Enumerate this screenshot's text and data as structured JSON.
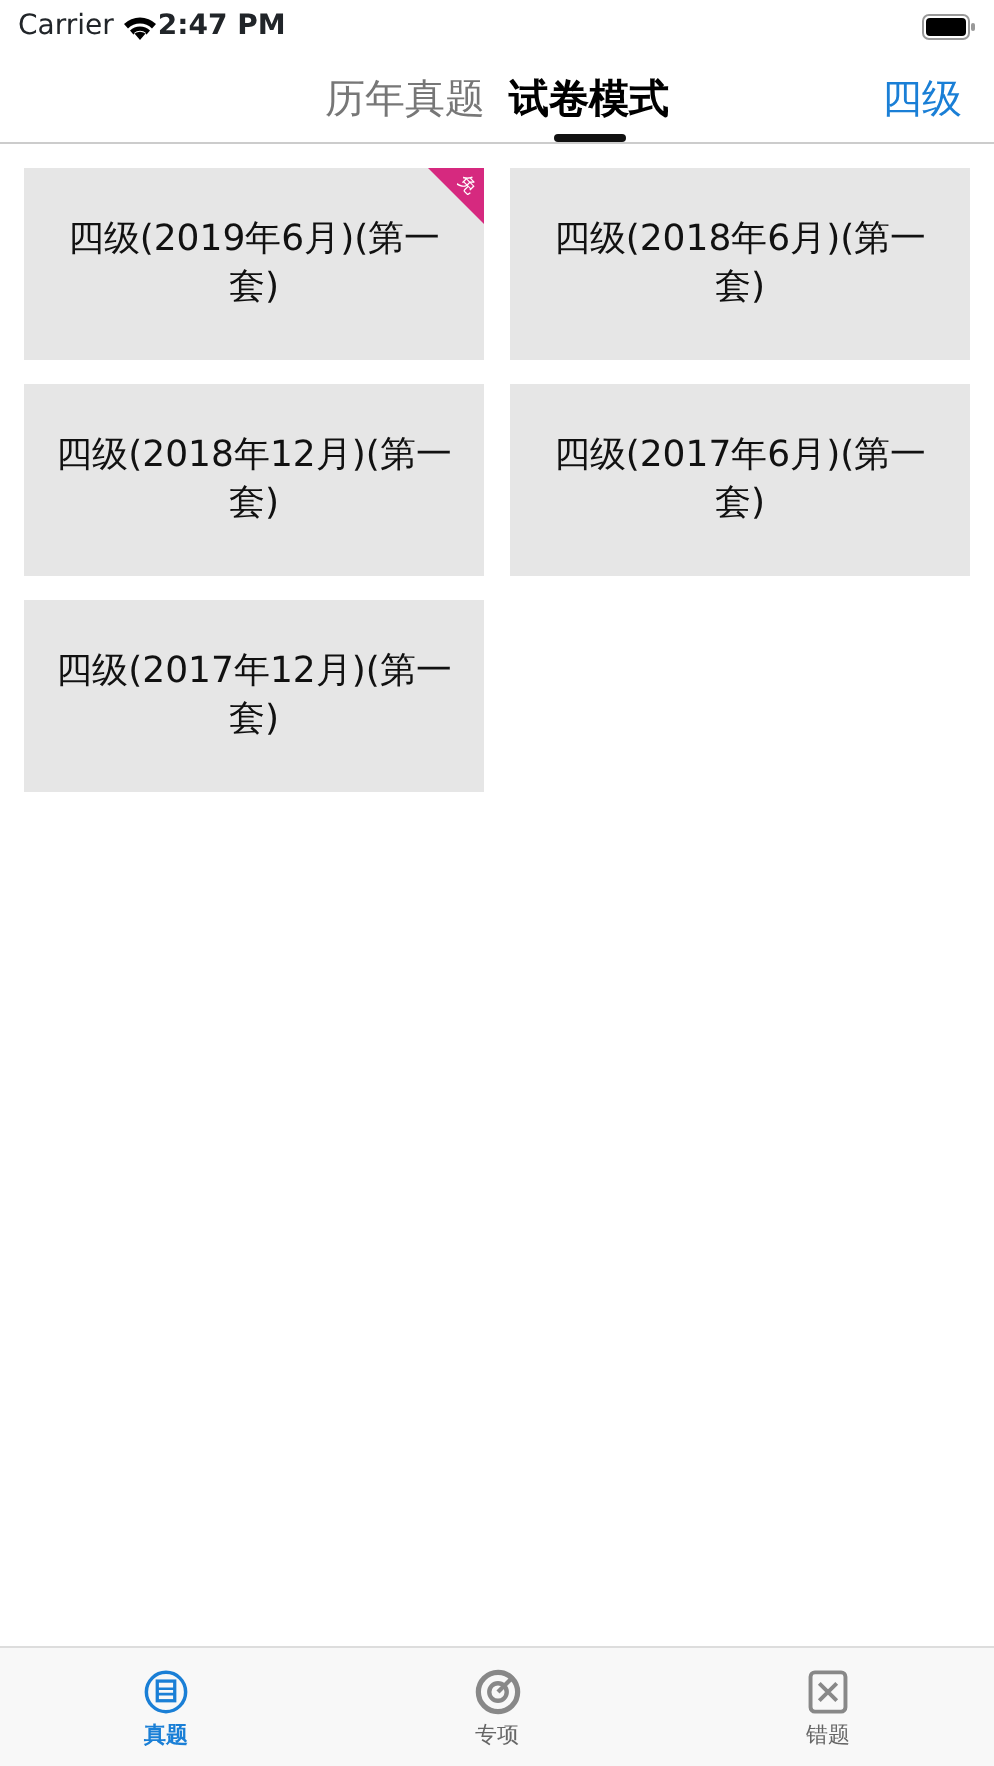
{
  "status_bar": {
    "carrier": "Carrier",
    "time": "2:47 PM"
  },
  "segments": [
    {
      "label": "历年真题",
      "selected": false
    },
    {
      "label": "试卷模式",
      "selected": true
    }
  ],
  "level_button": "四级",
  "papers": [
    {
      "title": "四级(2019年6月)(第一套)",
      "badge": "免"
    },
    {
      "title": "四级(2018年6月)(第一套)"
    },
    {
      "title": "四级(2018年12月)(第一套)"
    },
    {
      "title": "四级(2017年6月)(第一套)"
    },
    {
      "title": "四级(2017年12月)(第一套)"
    }
  ],
  "tab_bar": [
    {
      "label": "真题",
      "kind": "zhen",
      "selected": true
    },
    {
      "label": "专项",
      "kind": "target",
      "selected": false
    },
    {
      "label": "错题",
      "kind": "wrong",
      "selected": false
    }
  ]
}
